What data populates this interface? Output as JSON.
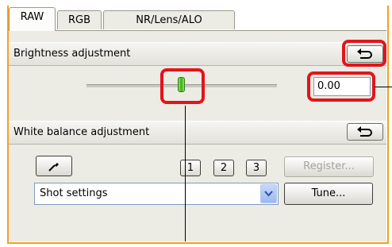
{
  "tabs": [
    {
      "label": "RAW",
      "active": true
    },
    {
      "label": "RGB",
      "active": false
    },
    {
      "label": "NR/Lens/ALO",
      "active": false
    }
  ],
  "brightness": {
    "title": "Brightness adjustment",
    "value": "0.00",
    "slider_level": 0.5
  },
  "white_balance": {
    "title": "White balance adjustment",
    "preset_buttons": [
      "1",
      "2",
      "3"
    ],
    "register_label": "Register...",
    "select_value": "Shot settings",
    "tune_label": "Tune..."
  },
  "icons": {
    "reset": "undo-arrow-icon",
    "picker": "eyedropper-icon",
    "dropdown": "chevron-down-icon"
  },
  "colors": {
    "callout_highlight": "#e3141b",
    "tab_frame": "#f4a020",
    "slider_thumb": "#36b000"
  }
}
